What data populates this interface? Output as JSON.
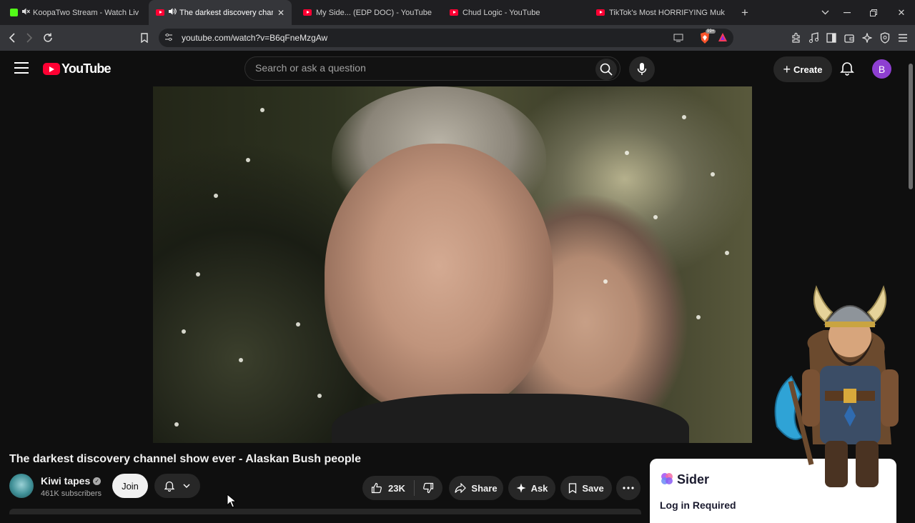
{
  "browser": {
    "tabs": [
      {
        "title": "KoopaTwo Stream - Watch Live o",
        "favicon": "kick-icon",
        "muted": true,
        "active": false
      },
      {
        "title": "The darkest discovery channe",
        "favicon": "youtube-icon",
        "audio": true,
        "active": true
      },
      {
        "title": "My Side... (EDP DOC) - YouTube",
        "favicon": "youtube-icon",
        "active": false
      },
      {
        "title": "Chud Logic - YouTube",
        "favicon": "youtube-icon",
        "active": false
      },
      {
        "title": "TikTok's Most HORRIFYING Mukbang",
        "favicon": "youtube-icon",
        "active": false
      }
    ],
    "url": "youtube.com/watch?v=B6qFneMzgAw",
    "brave_badge": "99+"
  },
  "youtube": {
    "logo_text": "YouTube",
    "search_placeholder": "Search or ask a question",
    "create_label": "Create",
    "avatar_initial": "B"
  },
  "video": {
    "title": "The darkest discovery channel show ever - Alaskan Bush people",
    "channel": {
      "name": "Kiwi tapes",
      "subscribers": "461K subscribers"
    },
    "join_label": "Join",
    "likes": "23K",
    "share_label": "Share",
    "ask_label": "Ask",
    "save_label": "Save"
  },
  "sider": {
    "name": "Sider",
    "status": "Log in Required"
  },
  "colors": {
    "yt_red": "#ff0033",
    "background": "#0f0f0f",
    "pill": "#272727",
    "avatar": "#8e3fd1",
    "kick_green": "#53fc18"
  }
}
